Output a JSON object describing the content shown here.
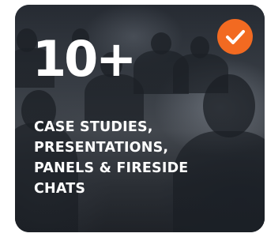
{
  "card": {
    "count": "10+",
    "caption_lines": [
      "CASE STUDIES,",
      "PRESENTATIONS,",
      "PANELS & FIRESIDE",
      "CHATS"
    ],
    "badge_icon": "checkmark-icon",
    "badge_color": "#f26a21"
  }
}
